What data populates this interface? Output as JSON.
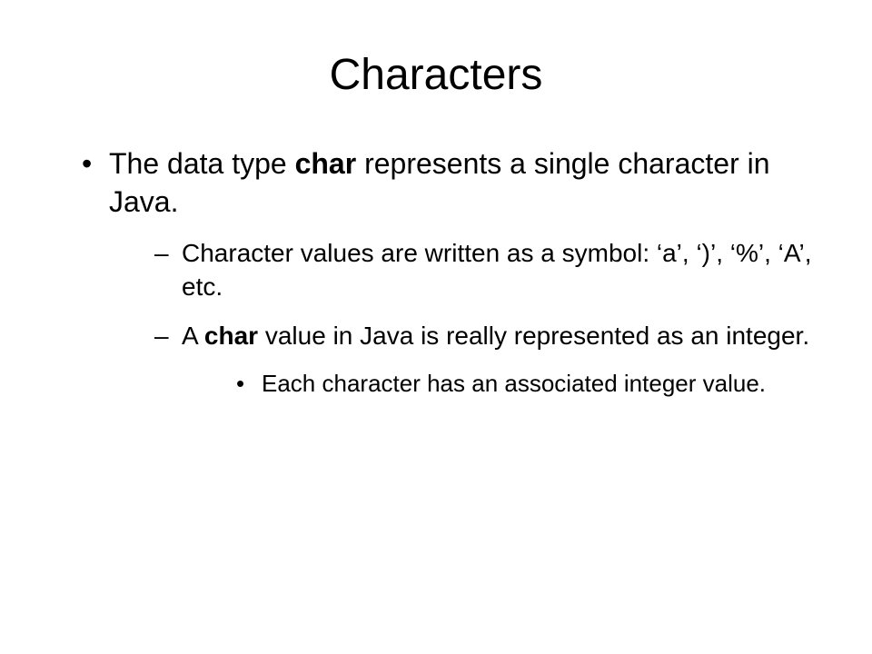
{
  "title": "Characters",
  "bullet1_part1": "The data type ",
  "bullet1_bold": "char",
  "bullet1_part2": " represents a single character in Java.",
  "bullet2": "Character values are written as a symbol: ‘a’, ‘)’, ‘%’, ‘A’, etc.",
  "bullet3_part1": "A ",
  "bullet3_bold": "char",
  "bullet3_part2": " value in Java is really represented as an integer.",
  "bullet4": "Each character has an associated integer value."
}
